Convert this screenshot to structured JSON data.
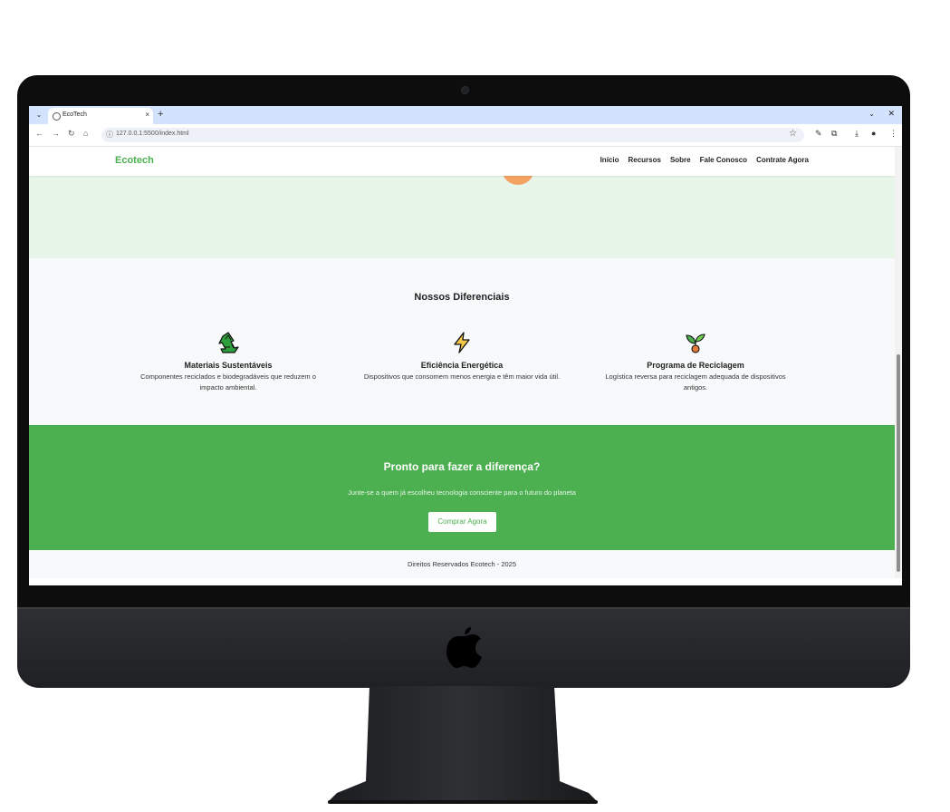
{
  "browser": {
    "tab_title": "EcoTech",
    "tab_close": "×",
    "new_tab": "+",
    "url": "127.0.0.1:5500/index.html",
    "window_minimize": "⌄",
    "window_close": "✕"
  },
  "site": {
    "logo": "Ecotech",
    "nav": [
      "Início",
      "Recursos",
      "Sobre",
      "Fale Conosco",
      "Contrate Agora"
    ],
    "features_title": "Nossos Diferenciais",
    "features": [
      {
        "icon": "recycle-icon",
        "title": "Materiais Sustentáveis",
        "description": "Componentes reciclados e biodegradáveis que reduzem o impacto ambiental."
      },
      {
        "icon": "lightning-icon",
        "title": "Eficiência Energética",
        "description": "Dispositivos que consomem menos energia e têm maior vida útil."
      },
      {
        "icon": "sprout-icon",
        "title": "Programa de Reciclagem",
        "description": "Logística reversa para reciclagem adequada de dispositivos antigos."
      }
    ],
    "cta_title": "Pronto para fazer a diferença?",
    "cta_text": "Junte-se a quem já escolheu tecnologia consciente para o futuro do planeta",
    "cta_button": "Comprar Agora",
    "footer": "Direitos Reservados Ecotech - 2025"
  },
  "colors": {
    "brand_green": "#4caf50",
    "hero_bg": "#e8f5e9",
    "section_bg": "#f7f9fa",
    "accent_orange": "#f4a261"
  }
}
